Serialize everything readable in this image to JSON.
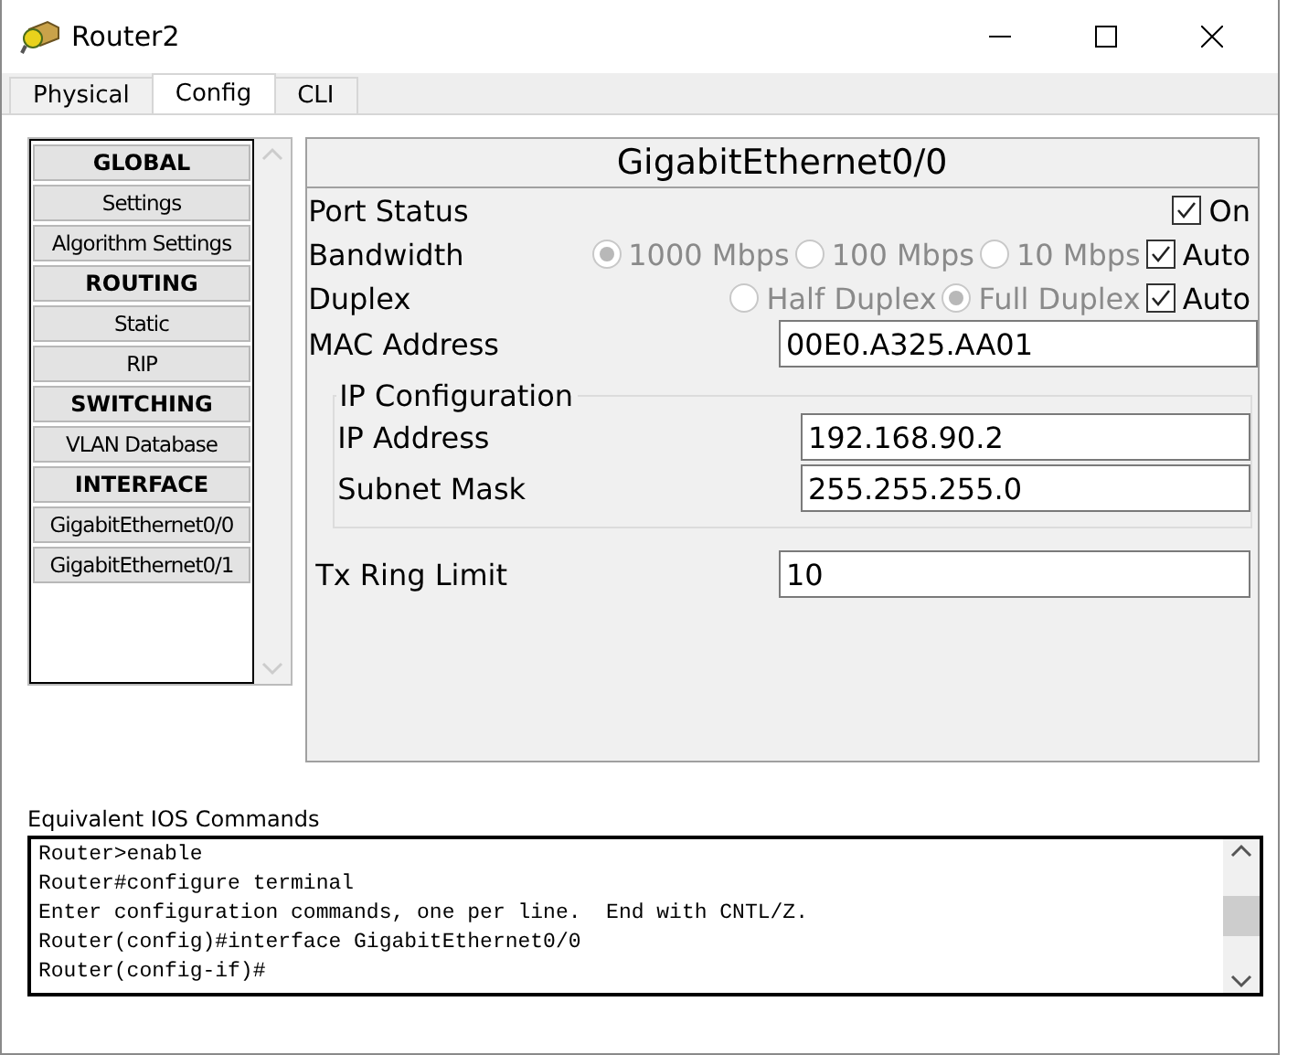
{
  "window": {
    "title": "Router2"
  },
  "tabs": [
    {
      "label": "Physical",
      "selected": false
    },
    {
      "label": "Config",
      "selected": true
    },
    {
      "label": "CLI",
      "selected": false
    }
  ],
  "sidebar": {
    "items": [
      {
        "label": "GLOBAL",
        "kind": "header"
      },
      {
        "label": "Settings",
        "kind": "item"
      },
      {
        "label": "Algorithm Settings",
        "kind": "item"
      },
      {
        "label": "ROUTING",
        "kind": "header"
      },
      {
        "label": "Static",
        "kind": "item"
      },
      {
        "label": "RIP",
        "kind": "item"
      },
      {
        "label": "SWITCHING",
        "kind": "header"
      },
      {
        "label": "VLAN Database",
        "kind": "item"
      },
      {
        "label": "INTERFACE",
        "kind": "header"
      },
      {
        "label": "GigabitEthernet0/0",
        "kind": "item"
      },
      {
        "label": "GigabitEthernet0/1",
        "kind": "item"
      }
    ]
  },
  "panel": {
    "title": "GigabitEthernet0/0",
    "port_status": {
      "label": "Port Status",
      "checkbox": {
        "label": "On",
        "checked": true
      }
    },
    "bandwidth": {
      "label": "Bandwidth",
      "options": [
        {
          "label": "1000 Mbps",
          "selected": true,
          "disabled": true
        },
        {
          "label": "100 Mbps",
          "selected": false,
          "disabled": true
        },
        {
          "label": "10 Mbps",
          "selected": false,
          "disabled": true
        }
      ],
      "auto": {
        "label": "Auto",
        "checked": true
      }
    },
    "duplex": {
      "label": "Duplex",
      "options": [
        {
          "label": "Half Duplex",
          "selected": false,
          "disabled": true
        },
        {
          "label": "Full Duplex",
          "selected": true,
          "disabled": true
        }
      ],
      "auto": {
        "label": "Auto",
        "checked": true
      }
    },
    "mac_address": {
      "label": "MAC Address",
      "value": "00E0.A325.AA01"
    },
    "ip_configuration": {
      "title": "IP Configuration",
      "fields": [
        {
          "label": "IP Address",
          "value": "192.168.90.2"
        },
        {
          "label": "Subnet Mask",
          "value": "255.255.255.0"
        }
      ]
    },
    "tx_ring_limit": {
      "label": "Tx Ring Limit",
      "value": "10"
    }
  },
  "ios_commands": {
    "label": "Equivalent IOS Commands",
    "lines": [
      "Router>enable",
      "Router#configure terminal",
      "Enter configuration commands, one per line.  End with CNTL/Z.",
      "Router(config)#interface GigabitEthernet0/0",
      "Router(config-if)#"
    ]
  }
}
